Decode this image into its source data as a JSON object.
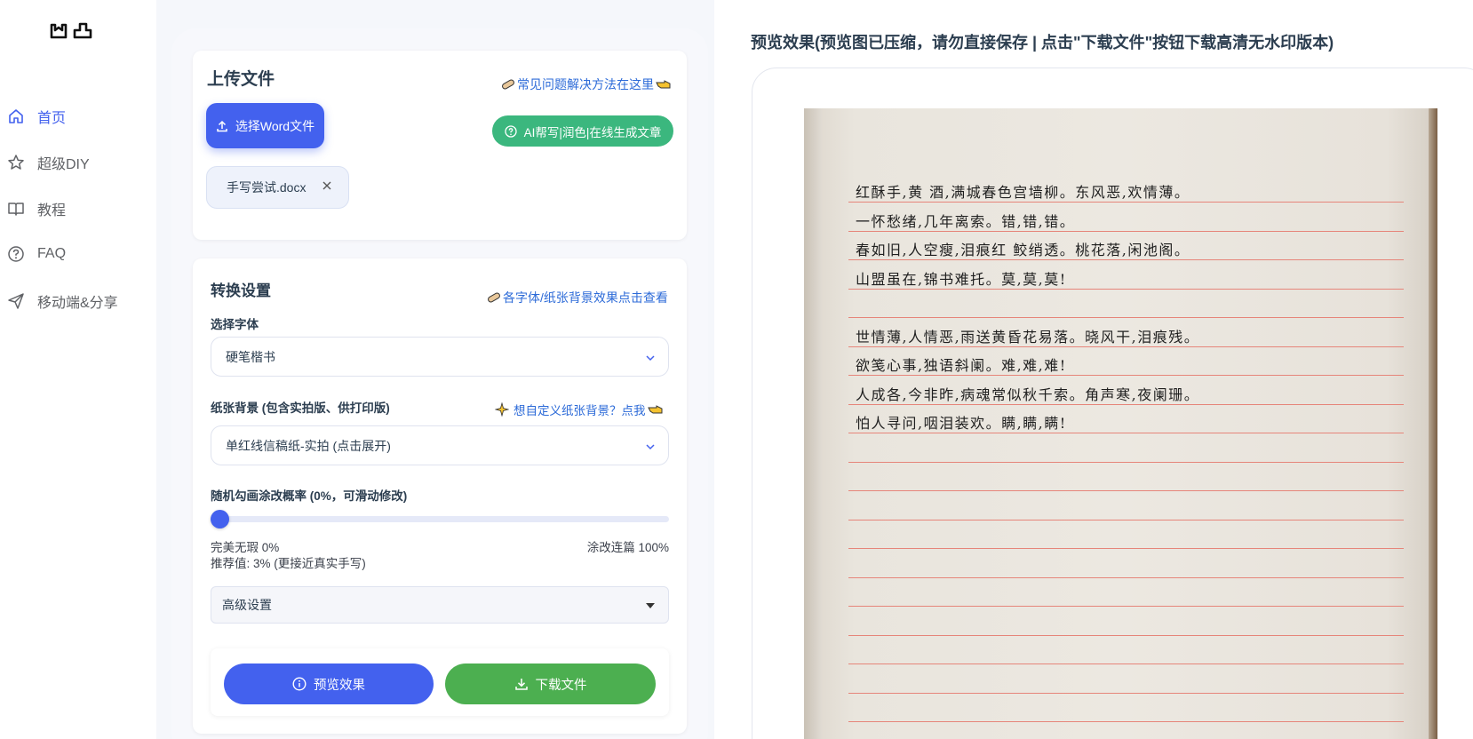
{
  "sidebar": {
    "items": [
      {
        "label": "首页",
        "icon": "home-icon",
        "active": true
      },
      {
        "label": "超级DIY",
        "icon": "star-icon",
        "active": false
      },
      {
        "label": "教程",
        "icon": "book-icon",
        "active": false
      },
      {
        "label": "FAQ",
        "icon": "question-circle-icon",
        "active": false
      },
      {
        "label": "移动端&分享",
        "icon": "send-icon",
        "active": false
      }
    ]
  },
  "upload": {
    "title": "上传文件",
    "faq_link": "常见问题解决方法在这里",
    "select_button": "选择Word文件",
    "ai_button": "AI帮写|润色|在线生成文章",
    "file_name": "手写尝试.docx"
  },
  "settings": {
    "title": "转换设置",
    "effects_link": "各字体/纸张背景效果点击查看",
    "font_label": "选择字体",
    "font_value": "硬笔楷书",
    "paper_label": "纸张背景 (包含实拍版、供打印版)",
    "custom_paper_link": "想自定义纸张背景？点我",
    "paper_value": "单红线信稿纸-实拍 (点击展开)",
    "prob_label": "随机勾画涂改概率 (0%，可滑动修改)",
    "prob_value": 0,
    "min_label": "完美无瑕 0%",
    "max_label": "涂改连篇 100%",
    "recommend": "推荐值: 3% (更接近真实手写)",
    "advanced_label": "高级设置"
  },
  "actions": {
    "preview_button": "预览效果",
    "download_button": "下载文件"
  },
  "preview": {
    "title": "预览效果(预览图已压缩，请勿直接保存 | 点击\"下载文件\"按钮下载高清无水印版本)",
    "lines": [
      "红酥手,黄 酒,满城春色宫墙柳。东风恶,欢情薄。",
      "一怀愁绪,几年离索。错,错,错。",
      "春如旧,人空瘦,泪痕红 鲛绡透。桃花落,闲池阁。",
      "山盟虽在,锦书难托。莫,莫,莫!",
      "",
      "世情薄,人情恶,雨送黄昏花易落。晓风干,泪痕残。",
      "欲笺心事,独语斜阑。难,难,难!",
      "人成各,今非昨,病魂常似秋千索。角声寒,夜阑珊。",
      "怕人寻问,咽泪装欢。瞒,瞒,瞒!"
    ]
  },
  "colors": {
    "primary": "#4361ee",
    "green": "#4caf50",
    "ai_green": "#3bb77e",
    "link": "#2d6bd8"
  }
}
